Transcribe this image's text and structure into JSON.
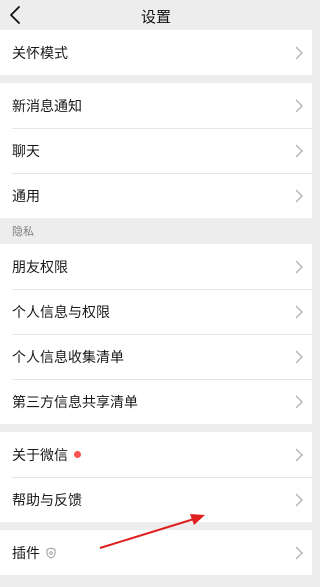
{
  "header": {
    "title": "设置"
  },
  "group1": [
    {
      "label": "关怀模式"
    }
  ],
  "group2": [
    {
      "label": "新消息通知"
    },
    {
      "label": "聊天"
    },
    {
      "label": "通用"
    }
  ],
  "privacy": {
    "section_label": "隐私",
    "items": [
      {
        "label": "朋友权限"
      },
      {
        "label": "个人信息与权限"
      },
      {
        "label": "个人信息收集清单"
      },
      {
        "label": "第三方信息共享清单"
      }
    ]
  },
  "group4": [
    {
      "label": "关于微信"
    },
    {
      "label": "帮助与反馈"
    }
  ],
  "group5": [
    {
      "label": "插件"
    }
  ],
  "colors": {
    "background": "#ededed",
    "badge": "#fa5151",
    "annotation_arrow": "#e02020"
  },
  "icons": [
    "back-arrow-icon",
    "chevron-right-icon",
    "red-dot-badge",
    "shield-icon"
  ]
}
